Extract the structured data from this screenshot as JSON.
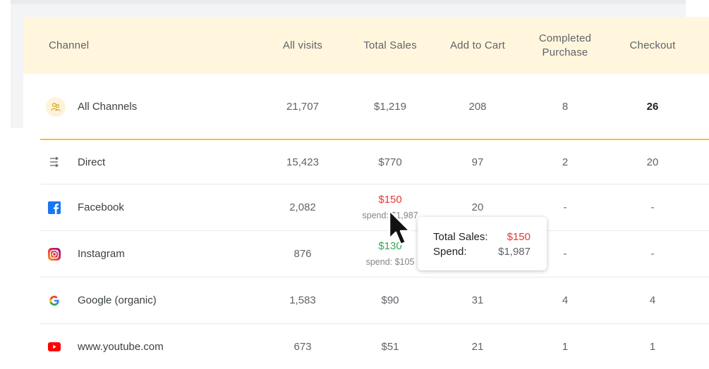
{
  "table": {
    "headers": {
      "channel": "Channel",
      "all_visits": "All visits",
      "total_sales": "Total Sales",
      "add_to_cart": "Add to Cart",
      "completed_purchase_l1": "Completed",
      "completed_purchase_l2": "Purchase",
      "checkout": "Checkout"
    },
    "summary": {
      "icon": "channels-icon",
      "channel": "All Channels",
      "all_visits": "21,707",
      "total_sales": "$1,219",
      "add_to_cart": "208",
      "completed_purchase": "8",
      "checkout": "26"
    },
    "rows": [
      {
        "icon": "direct-arrows-icon",
        "channel": "Direct",
        "all_visits": "15,423",
        "total_sales": "$770",
        "add_to_cart": "97",
        "completed_purchase": "2",
        "checkout": "20"
      },
      {
        "icon": "facebook-icon",
        "channel": "Facebook",
        "all_visits": "2,082",
        "total_sales": "$150",
        "spend": "spend: $1,987",
        "add_to_cart": "20",
        "completed_purchase": "-",
        "checkout": "-"
      },
      {
        "icon": "instagram-icon",
        "channel": "Instagram",
        "all_visits": "876",
        "total_sales": "$130",
        "spend": "spend: $105",
        "add_to_cart": "",
        "completed_purchase": "-",
        "checkout": "-"
      },
      {
        "icon": "google-icon",
        "channel": "Google (organic)",
        "all_visits": "1,583",
        "total_sales": "$90",
        "add_to_cart": "31",
        "completed_purchase": "4",
        "checkout": "4"
      },
      {
        "icon": "youtube-icon",
        "channel": "www.youtube.com",
        "all_visits": "673",
        "total_sales": "$51",
        "add_to_cart": "21",
        "completed_purchase": "1",
        "checkout": "1"
      }
    ]
  },
  "tooltip": {
    "total_sales_label": "Total Sales:",
    "total_sales_value": "$150",
    "spend_label": "Spend:",
    "spend_value": "$1,987"
  },
  "colors": {
    "header_bg": "#fff6dd",
    "accent": "#f5c230",
    "sales_red": "#e53935",
    "sales_green": "#34a853"
  }
}
